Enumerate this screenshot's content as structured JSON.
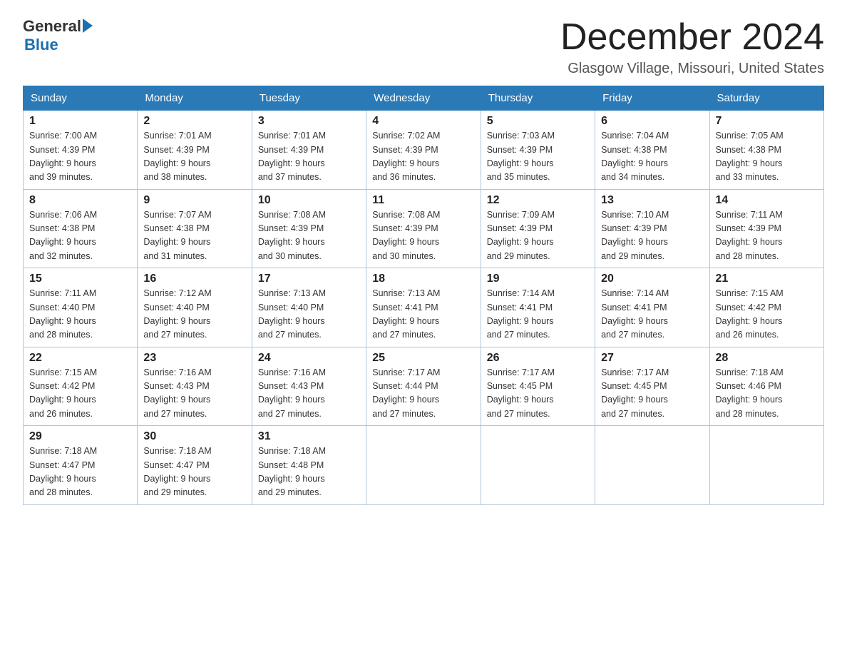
{
  "header": {
    "logo_general": "General",
    "logo_blue": "Blue",
    "month_title": "December 2024",
    "location": "Glasgow Village, Missouri, United States"
  },
  "days_of_week": [
    "Sunday",
    "Monday",
    "Tuesday",
    "Wednesday",
    "Thursday",
    "Friday",
    "Saturday"
  ],
  "weeks": [
    [
      {
        "day": "1",
        "sunrise": "7:00 AM",
        "sunset": "4:39 PM",
        "daylight": "9 hours and 39 minutes."
      },
      {
        "day": "2",
        "sunrise": "7:01 AM",
        "sunset": "4:39 PM",
        "daylight": "9 hours and 38 minutes."
      },
      {
        "day": "3",
        "sunrise": "7:01 AM",
        "sunset": "4:39 PM",
        "daylight": "9 hours and 37 minutes."
      },
      {
        "day": "4",
        "sunrise": "7:02 AM",
        "sunset": "4:39 PM",
        "daylight": "9 hours and 36 minutes."
      },
      {
        "day": "5",
        "sunrise": "7:03 AM",
        "sunset": "4:39 PM",
        "daylight": "9 hours and 35 minutes."
      },
      {
        "day": "6",
        "sunrise": "7:04 AM",
        "sunset": "4:38 PM",
        "daylight": "9 hours and 34 minutes."
      },
      {
        "day": "7",
        "sunrise": "7:05 AM",
        "sunset": "4:38 PM",
        "daylight": "9 hours and 33 minutes."
      }
    ],
    [
      {
        "day": "8",
        "sunrise": "7:06 AM",
        "sunset": "4:38 PM",
        "daylight": "9 hours and 32 minutes."
      },
      {
        "day": "9",
        "sunrise": "7:07 AM",
        "sunset": "4:38 PM",
        "daylight": "9 hours and 31 minutes."
      },
      {
        "day": "10",
        "sunrise": "7:08 AM",
        "sunset": "4:39 PM",
        "daylight": "9 hours and 30 minutes."
      },
      {
        "day": "11",
        "sunrise": "7:08 AM",
        "sunset": "4:39 PM",
        "daylight": "9 hours and 30 minutes."
      },
      {
        "day": "12",
        "sunrise": "7:09 AM",
        "sunset": "4:39 PM",
        "daylight": "9 hours and 29 minutes."
      },
      {
        "day": "13",
        "sunrise": "7:10 AM",
        "sunset": "4:39 PM",
        "daylight": "9 hours and 29 minutes."
      },
      {
        "day": "14",
        "sunrise": "7:11 AM",
        "sunset": "4:39 PM",
        "daylight": "9 hours and 28 minutes."
      }
    ],
    [
      {
        "day": "15",
        "sunrise": "7:11 AM",
        "sunset": "4:40 PM",
        "daylight": "9 hours and 28 minutes."
      },
      {
        "day": "16",
        "sunrise": "7:12 AM",
        "sunset": "4:40 PM",
        "daylight": "9 hours and 27 minutes."
      },
      {
        "day": "17",
        "sunrise": "7:13 AM",
        "sunset": "4:40 PM",
        "daylight": "9 hours and 27 minutes."
      },
      {
        "day": "18",
        "sunrise": "7:13 AM",
        "sunset": "4:41 PM",
        "daylight": "9 hours and 27 minutes."
      },
      {
        "day": "19",
        "sunrise": "7:14 AM",
        "sunset": "4:41 PM",
        "daylight": "9 hours and 27 minutes."
      },
      {
        "day": "20",
        "sunrise": "7:14 AM",
        "sunset": "4:41 PM",
        "daylight": "9 hours and 27 minutes."
      },
      {
        "day": "21",
        "sunrise": "7:15 AM",
        "sunset": "4:42 PM",
        "daylight": "9 hours and 26 minutes."
      }
    ],
    [
      {
        "day": "22",
        "sunrise": "7:15 AM",
        "sunset": "4:42 PM",
        "daylight": "9 hours and 26 minutes."
      },
      {
        "day": "23",
        "sunrise": "7:16 AM",
        "sunset": "4:43 PM",
        "daylight": "9 hours and 27 minutes."
      },
      {
        "day": "24",
        "sunrise": "7:16 AM",
        "sunset": "4:43 PM",
        "daylight": "9 hours and 27 minutes."
      },
      {
        "day": "25",
        "sunrise": "7:17 AM",
        "sunset": "4:44 PM",
        "daylight": "9 hours and 27 minutes."
      },
      {
        "day": "26",
        "sunrise": "7:17 AM",
        "sunset": "4:45 PM",
        "daylight": "9 hours and 27 minutes."
      },
      {
        "day": "27",
        "sunrise": "7:17 AM",
        "sunset": "4:45 PM",
        "daylight": "9 hours and 27 minutes."
      },
      {
        "day": "28",
        "sunrise": "7:18 AM",
        "sunset": "4:46 PM",
        "daylight": "9 hours and 28 minutes."
      }
    ],
    [
      {
        "day": "29",
        "sunrise": "7:18 AM",
        "sunset": "4:47 PM",
        "daylight": "9 hours and 28 minutes."
      },
      {
        "day": "30",
        "sunrise": "7:18 AM",
        "sunset": "4:47 PM",
        "daylight": "9 hours and 29 minutes."
      },
      {
        "day": "31",
        "sunrise": "7:18 AM",
        "sunset": "4:48 PM",
        "daylight": "9 hours and 29 minutes."
      },
      null,
      null,
      null,
      null
    ]
  ]
}
